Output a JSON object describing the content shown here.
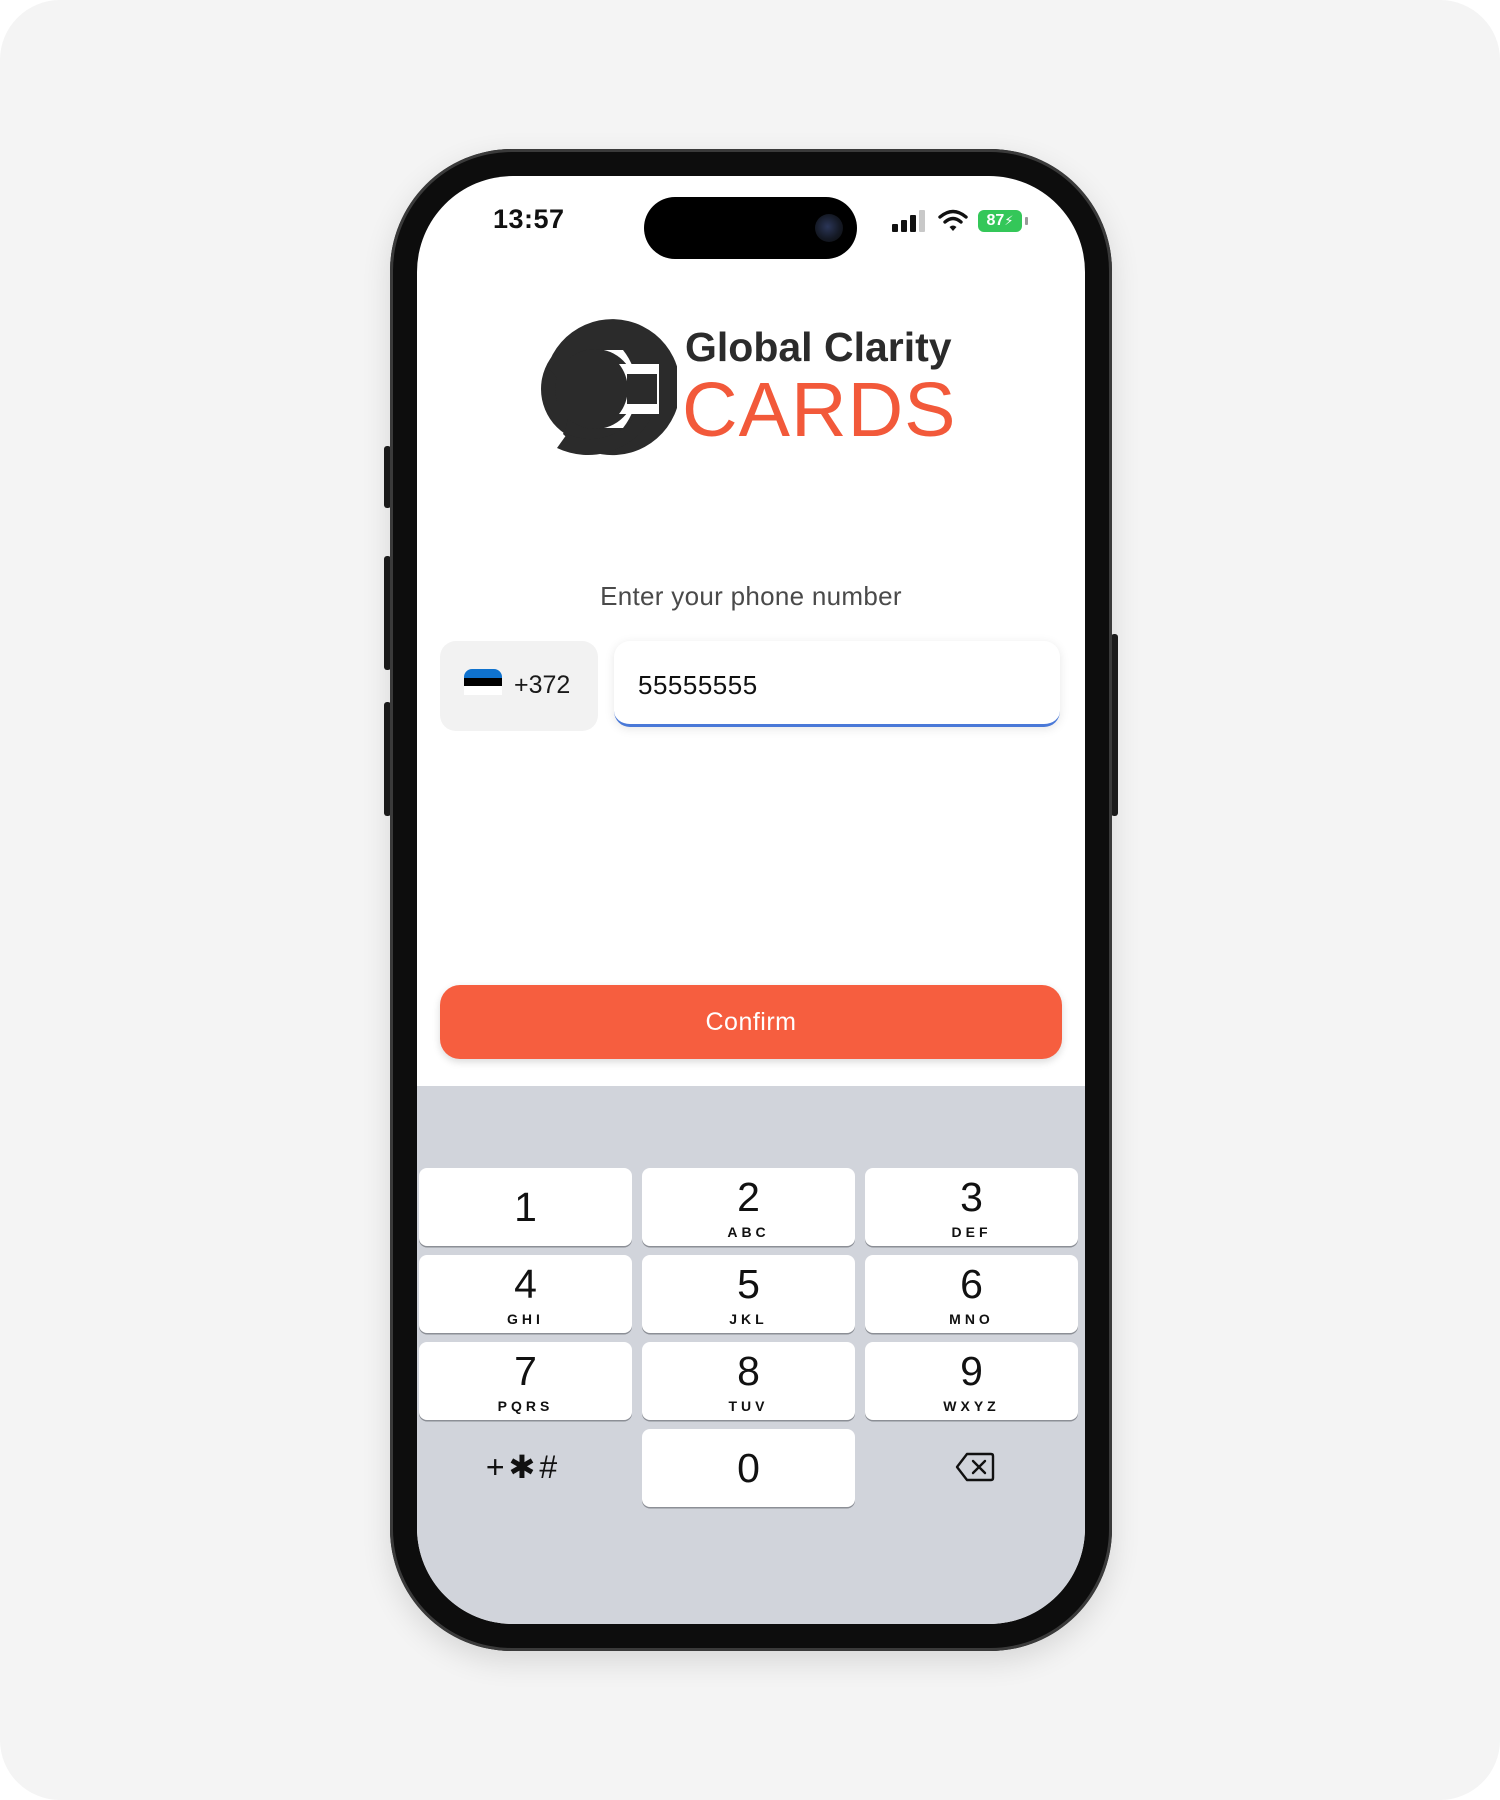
{
  "status_bar": {
    "time": "13:57",
    "battery": "87"
  },
  "brand": {
    "name_top": "Global Clarity",
    "name_bottom": "CARDS"
  },
  "login": {
    "prompt": "Enter your phone number",
    "country_code": "+372",
    "phone_value": "55555555",
    "confirm_label": "Confirm"
  },
  "keypad": {
    "keys": [
      {
        "digit": "1",
        "letters": ""
      },
      {
        "digit": "2",
        "letters": "ABC"
      },
      {
        "digit": "3",
        "letters": "DEF"
      },
      {
        "digit": "4",
        "letters": "GHI"
      },
      {
        "digit": "5",
        "letters": "JKL"
      },
      {
        "digit": "6",
        "letters": "MNO"
      },
      {
        "digit": "7",
        "letters": "PQRS"
      },
      {
        "digit": "8",
        "letters": "TUV"
      },
      {
        "digit": "9",
        "letters": "WXYZ"
      },
      {
        "digit": "0",
        "letters": ""
      }
    ],
    "symbols": "+✱#"
  },
  "colors": {
    "accent": "#f65e3f",
    "input_underline": "#4a79d8",
    "keyboard_bg": "#d1d4db"
  }
}
